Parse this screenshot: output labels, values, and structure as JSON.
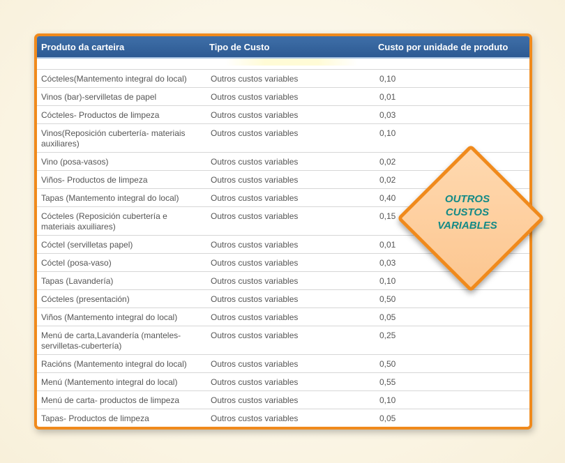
{
  "table": {
    "headers": [
      "Produto da carteira",
      "Tipo de Custo",
      "Custo por unidade de produto"
    ],
    "rows": [
      {
        "product": "Cócteles(Mantemento integral do local)",
        "type": "Outros custos variables",
        "cost": "0,10"
      },
      {
        "product": "Vinos (bar)-servilletas de papel",
        "type": "Outros custos variables",
        "cost": "0,01"
      },
      {
        "product": "Cócteles- Productos de limpeza",
        "type": "Outros custos variables",
        "cost": "0,03"
      },
      {
        "product": "Vinos(Reposición cubertería- materiais auxiliares)",
        "type": "Outros custos variables",
        "cost": "0,10"
      },
      {
        "product": "Vino (posa-vasos)",
        "type": "Outros custos variables",
        "cost": "0,02"
      },
      {
        "product": "Viños- Productos de limpeza",
        "type": "Outros custos variables",
        "cost": "0,02"
      },
      {
        "product": "Tapas (Mantemento integral do local)",
        "type": "Outros custos variables",
        "cost": "0,40"
      },
      {
        "product": "Cócteles (Reposición cubertería e materiais axuiliares)",
        "type": "Outros custos variables",
        "cost": "0,15"
      },
      {
        "product": "Cóctel (servilletas papel)",
        "type": "Outros custos variables",
        "cost": "0,01"
      },
      {
        "product": "Cóctel (posa-vaso)",
        "type": "Outros custos variables",
        "cost": "0,03"
      },
      {
        "product": "Tapas (Lavandería)",
        "type": "Outros custos variables",
        "cost": "0,10"
      },
      {
        "product": "Cócteles (presentación)",
        "type": "Outros custos variables",
        "cost": "0,50"
      },
      {
        "product": "Viños (Mantemento integral do local)",
        "type": "Outros custos variables",
        "cost": "0,05"
      },
      {
        "product": "Menú de carta,Lavandería (manteles-servilletas-cubertería)",
        "type": "Outros custos variables",
        "cost": "0,25"
      },
      {
        "product": "Racións (Mantemento integral do local)",
        "type": "Outros custos variables",
        "cost": "0,50"
      },
      {
        "product": "Menú (Mantemento integral do local)",
        "type": "Outros custos variables",
        "cost": "0,55"
      },
      {
        "product": "Menú de carta- productos de limpeza",
        "type": "Outros custos variables",
        "cost": "0,10"
      },
      {
        "product": "Tapas- Productos de limpeza",
        "type": "Outros custos variables",
        "cost": "0,05"
      }
    ]
  },
  "badge": {
    "lines": [
      "OUTROS",
      "CUSTOS",
      "VARIABLES"
    ]
  },
  "colors": {
    "accent": "#f08a1c",
    "header": "#2d5a93",
    "badge_text": "#138a86"
  }
}
